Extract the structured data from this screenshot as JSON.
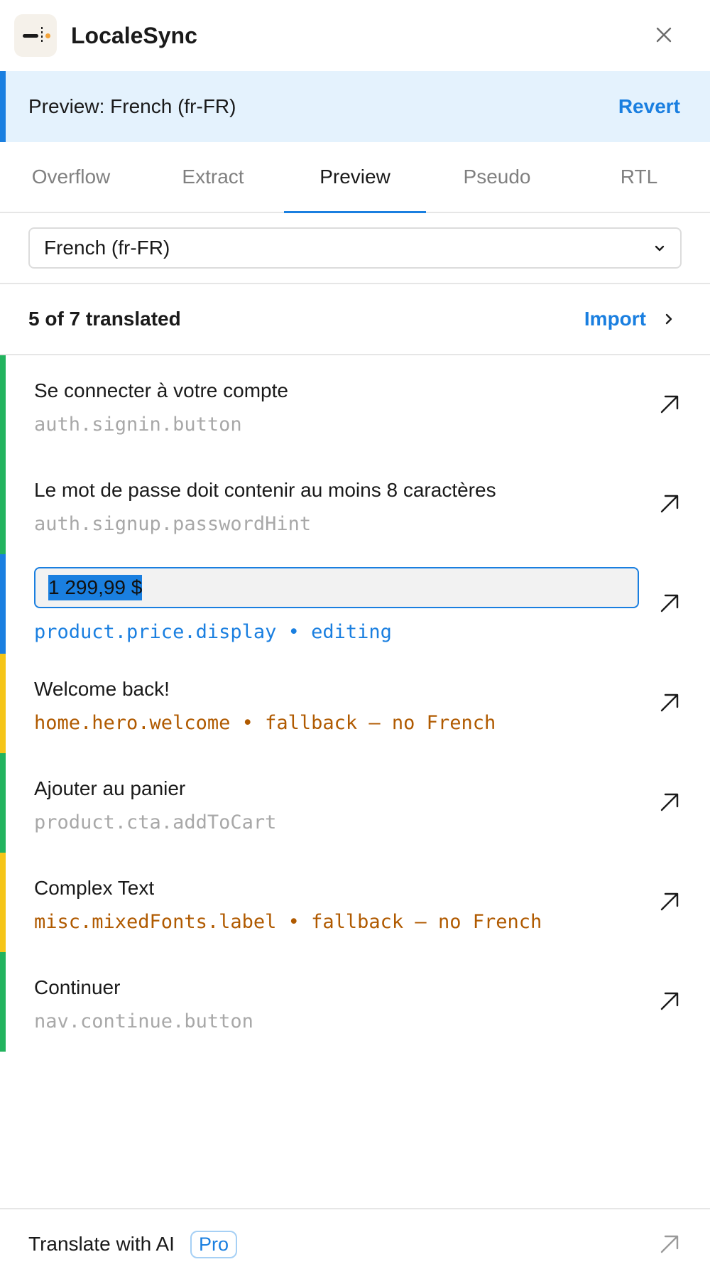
{
  "app": {
    "title": "LocaleSync"
  },
  "banner": {
    "text": "Preview: French (fr-FR)",
    "revert_label": "Revert"
  },
  "tabs": [
    {
      "label": "Overflow",
      "active": false
    },
    {
      "label": "Extract",
      "active": false
    },
    {
      "label": "Preview",
      "active": true
    },
    {
      "label": "Pseudo",
      "active": false
    },
    {
      "label": "RTL",
      "active": false
    }
  ],
  "locale_select": {
    "value": "French (fr-FR)"
  },
  "summary": {
    "count_text": "5 of 7 translated",
    "import_label": "Import"
  },
  "strings": [
    {
      "text": "Se connecter à votre compte",
      "key": "auth.signin.button",
      "status": "translated",
      "key_line": "auth.signin.button"
    },
    {
      "text": "Le mot de passe doit contenir au moins 8 caractères",
      "key": "auth.signup.passwordHint",
      "status": "translated",
      "key_line": "auth.signup.passwordHint"
    },
    {
      "text": "1 299,99 $",
      "key": "product.price.display",
      "status": "editing",
      "key_line": "product.price.display  •  editing"
    },
    {
      "text": "Welcome back!",
      "key": "home.hero.welcome",
      "status": "fallback",
      "key_line": "home.hero.welcome  •  fallback — no French"
    },
    {
      "text": "Ajouter au panier",
      "key": "product.cta.addToCart",
      "status": "translated",
      "key_line": "product.cta.addToCart"
    },
    {
      "text": "Complex Text",
      "key": "misc.mixedFonts.label",
      "status": "fallback",
      "key_line": "misc.mixedFonts.label  •  fallback — no French"
    },
    {
      "text": "Continuer",
      "key": "nav.continue.button",
      "status": "translated",
      "key_line": "nav.continue.button"
    }
  ],
  "footer": {
    "label": "Translate with AI",
    "badge": "Pro"
  },
  "colors": {
    "accent": "#1a7fe0",
    "translated": "#22b35e",
    "editing": "#1a7fe0",
    "fallback": "#f5c518",
    "fallback_text": "#b05a00",
    "banner_bg": "#e4f2fd"
  }
}
